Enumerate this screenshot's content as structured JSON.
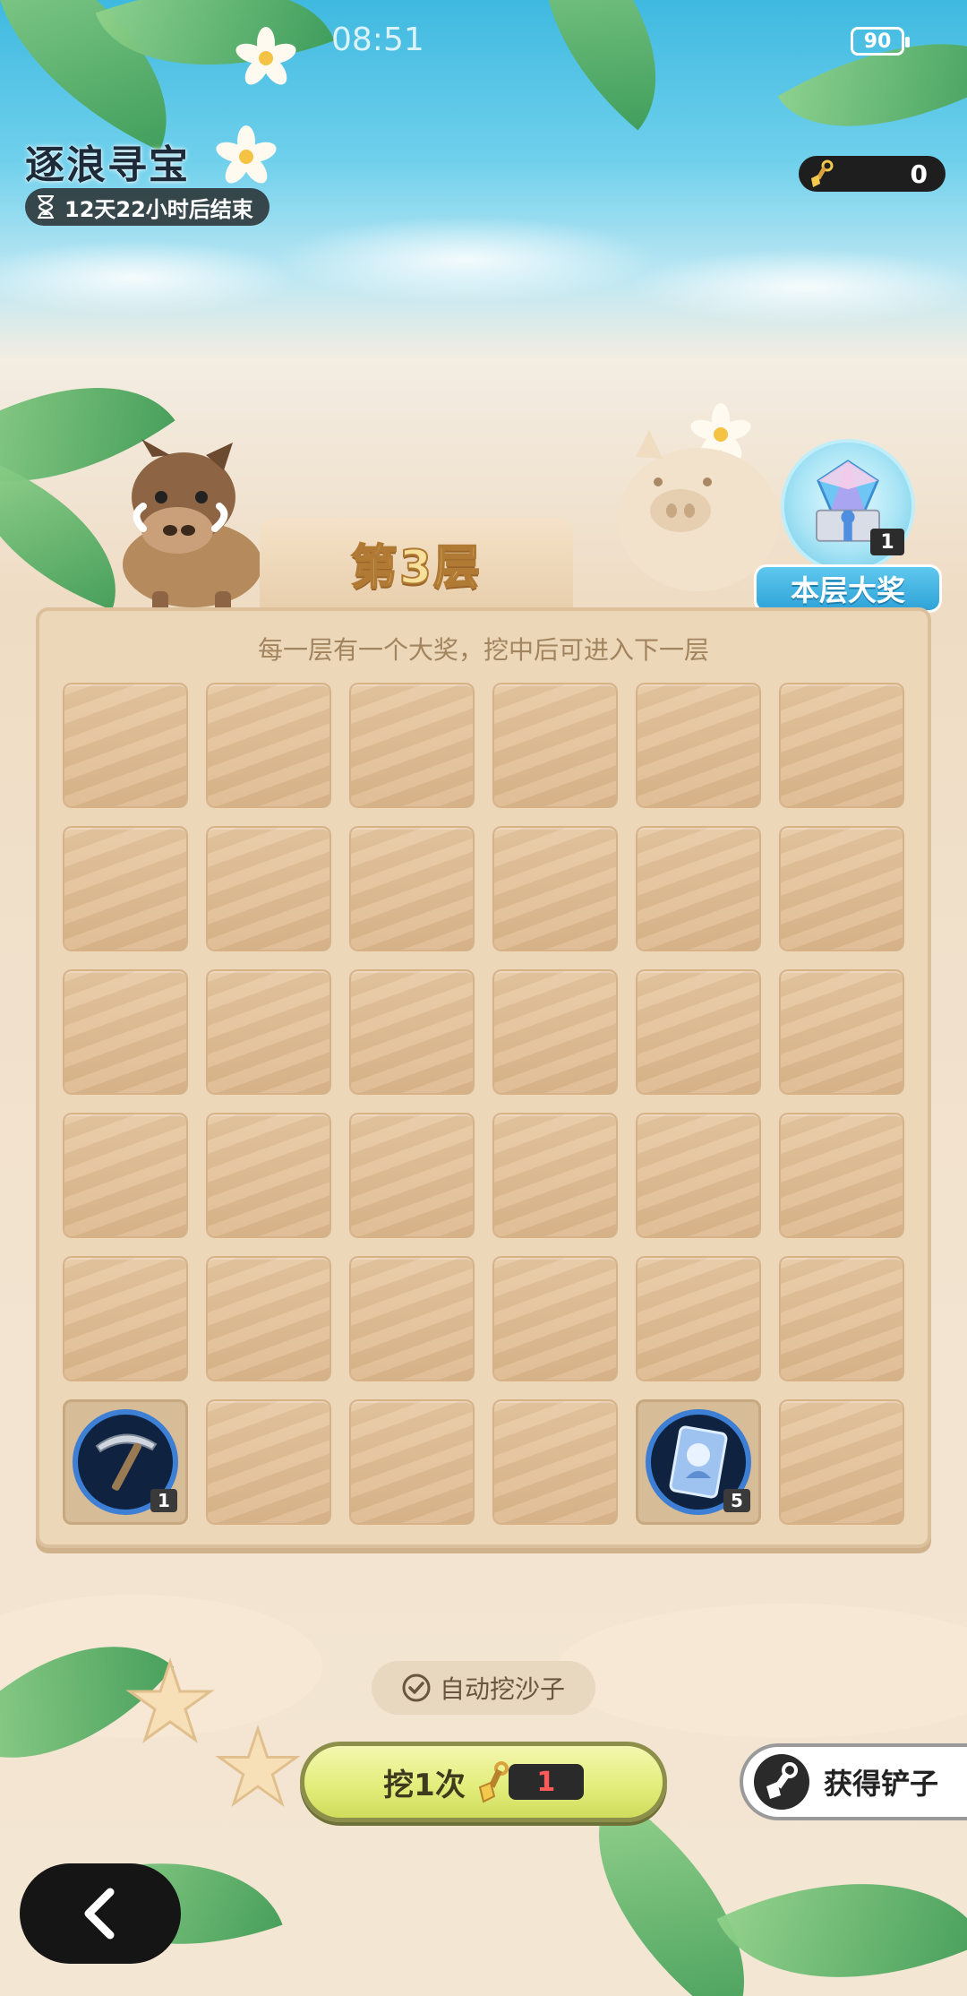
{
  "status_bar": {
    "time": "08:51",
    "battery": "90"
  },
  "header": {
    "title": "逐浪寻宝",
    "countdown": "12天22小时后结束",
    "shovel_count": "0"
  },
  "floor": {
    "label": "第3层"
  },
  "grand_prize": {
    "label": "本层大奖",
    "count": "1",
    "icon": "diamond-chest-icon"
  },
  "board": {
    "hint": "每一层有一个大奖，挖中后可进入下一层",
    "rows": 6,
    "cols": 6,
    "revealed": [
      {
        "row": 6,
        "col": 1,
        "icon": "pickaxe-icon",
        "count": "1"
      },
      {
        "row": 6,
        "col": 5,
        "icon": "card-icon",
        "count": "5"
      }
    ]
  },
  "controls": {
    "auto_dig_label": "自动挖沙子",
    "auto_dig_checked": true,
    "dig_label": "挖1次",
    "dig_cost": "1",
    "get_shovel_label": "获得铲子"
  },
  "colors": {
    "accent_blue": "#2fa3d8",
    "dig_button": "#e3ee7c",
    "cost_text": "#ff5a5a"
  }
}
